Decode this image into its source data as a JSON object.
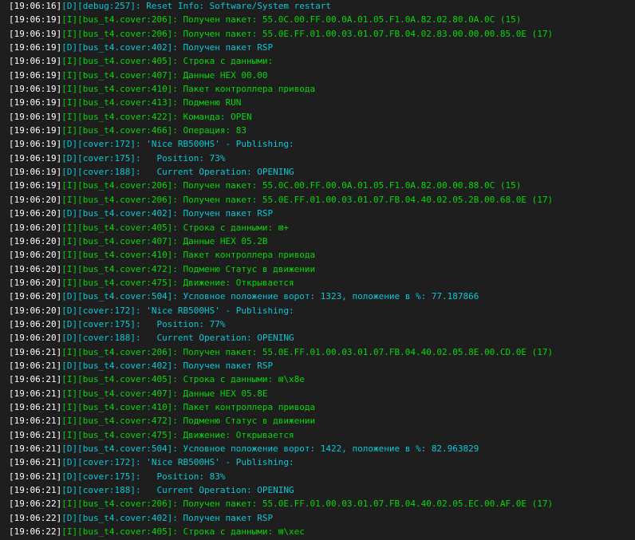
{
  "console": {
    "lines": [
      {
        "timestamp": "[19:06:16]",
        "level": "D",
        "message": "[D][debug:257]: Reset Info: Software/System restart"
      },
      {
        "timestamp": "[19:06:19]",
        "level": "I",
        "message": "[I][bus_t4.cover:206]: Получен пакет: 55.0C.00.FF.00.0A.01.05.F1.0A.82.02.80.0A.0C (15)"
      },
      {
        "timestamp": "[19:06:19]",
        "level": "I",
        "message": "[I][bus_t4.cover:206]: Получен пакет: 55.0E.FF.01.00.03.01.07.FB.04.02.83.00.00.00.85.0E (17)"
      },
      {
        "timestamp": "[19:06:19]",
        "level": "D",
        "message": "[D][bus_t4.cover:402]: Получен пакет RSP"
      },
      {
        "timestamp": "[19:06:19]",
        "level": "I",
        "message": "[I][bus_t4.cover:405]: Строка с данными:"
      },
      {
        "timestamp": "[19:06:19]",
        "level": "I",
        "message": "[I][bus_t4.cover:407]: Данные HEX 00.00"
      },
      {
        "timestamp": "[19:06:19]",
        "level": "I",
        "message": "[I][bus_t4.cover:410]: Пакет контроллера привода"
      },
      {
        "timestamp": "[19:06:19]",
        "level": "I",
        "message": "[I][bus_t4.cover:413]: Подменю RUN"
      },
      {
        "timestamp": "[19:06:19]",
        "level": "I",
        "message": "[I][bus_t4.cover:422]: Команда: OPEN"
      },
      {
        "timestamp": "[19:06:19]",
        "level": "I",
        "message": "[I][bus_t4.cover:466]: Операция: 83"
      },
      {
        "timestamp": "[19:06:19]",
        "level": "D",
        "message": "[D][cover:172]: 'Nice RB500HS' - Publishing:"
      },
      {
        "timestamp": "[19:06:19]",
        "level": "D",
        "message": "[D][cover:175]:   Position: 73%"
      },
      {
        "timestamp": "[19:06:19]",
        "level": "D",
        "message": "[D][cover:188]:   Current Operation: OPENING"
      },
      {
        "timestamp": "[19:06:19]",
        "level": "I",
        "message": "[I][bus_t4.cover:206]: Получен пакет: 55.0C.00.FF.00.0A.01.05.F1.0A.82.00.00.88.0C (15)"
      },
      {
        "timestamp": "[19:06:20]",
        "level": "I",
        "message": "[I][bus_t4.cover:206]: Получен пакет: 55.0E.FF.01.00.03.01.07.FB.04.40.02.05.2B.00.68.0E (17)"
      },
      {
        "timestamp": "[19:06:20]",
        "level": "D",
        "message": "[D][bus_t4.cover:402]: Получен пакет RSP"
      },
      {
        "timestamp": "[19:06:20]",
        "level": "I",
        "message": "[I][bus_t4.cover:405]: Строка с данными: ⊠+"
      },
      {
        "timestamp": "[19:06:20]",
        "level": "I",
        "message": "[I][bus_t4.cover:407]: Данные HEX 05.2B"
      },
      {
        "timestamp": "[19:06:20]",
        "level": "I",
        "message": "[I][bus_t4.cover:410]: Пакет контроллера привода"
      },
      {
        "timestamp": "[19:06:20]",
        "level": "I",
        "message": "[I][bus_t4.cover:472]: Подменю Статус в движении"
      },
      {
        "timestamp": "[19:06:20]",
        "level": "I",
        "message": "[I][bus_t4.cover:475]: Движение: Открывается"
      },
      {
        "timestamp": "[19:06:20]",
        "level": "D",
        "message": "[D][bus_t4.cover:504]: Условное положение ворот: 1323, положение в %: 77.187866"
      },
      {
        "timestamp": "[19:06:20]",
        "level": "D",
        "message": "[D][cover:172]: 'Nice RB500HS' - Publishing:"
      },
      {
        "timestamp": "[19:06:20]",
        "level": "D",
        "message": "[D][cover:175]:   Position: 77%"
      },
      {
        "timestamp": "[19:06:20]",
        "level": "D",
        "message": "[D][cover:188]:   Current Operation: OPENING"
      },
      {
        "timestamp": "[19:06:21]",
        "level": "I",
        "message": "[I][bus_t4.cover:206]: Получен пакет: 55.0E.FF.01.00.03.01.07.FB.04.40.02.05.8E.00.CD.0E (17)"
      },
      {
        "timestamp": "[19:06:21]",
        "level": "D",
        "message": "[D][bus_t4.cover:402]: Получен пакет RSP"
      },
      {
        "timestamp": "[19:06:21]",
        "level": "I",
        "message": "[I][bus_t4.cover:405]: Строка с данными: ⊠\\x8e"
      },
      {
        "timestamp": "[19:06:21]",
        "level": "I",
        "message": "[I][bus_t4.cover:407]: Данные HEX 05.8E"
      },
      {
        "timestamp": "[19:06:21]",
        "level": "I",
        "message": "[I][bus_t4.cover:410]: Пакет контроллера привода"
      },
      {
        "timestamp": "[19:06:21]",
        "level": "I",
        "message": "[I][bus_t4.cover:472]: Подменю Статус в движении"
      },
      {
        "timestamp": "[19:06:21]",
        "level": "I",
        "message": "[I][bus_t4.cover:475]: Движение: Открывается"
      },
      {
        "timestamp": "[19:06:21]",
        "level": "D",
        "message": "[D][bus_t4.cover:504]: Условное положение ворот: 1422, положение в %: 82.963829"
      },
      {
        "timestamp": "[19:06:21]",
        "level": "D",
        "message": "[D][cover:172]: 'Nice RB500HS' - Publishing:"
      },
      {
        "timestamp": "[19:06:21]",
        "level": "D",
        "message": "[D][cover:175]:   Position: 83%"
      },
      {
        "timestamp": "[19:06:21]",
        "level": "D",
        "message": "[D][cover:188]:   Current Operation: OPENING"
      },
      {
        "timestamp": "[19:06:22]",
        "level": "I",
        "message": "[I][bus_t4.cover:206]: Получен пакет: 55.0E.FF.01.00.03.01.07.FB.04.40.02.05.EC.00.AF.0E (17)"
      },
      {
        "timestamp": "[19:06:22]",
        "level": "D",
        "message": "[D][bus_t4.cover:402]: Получен пакет RSP"
      },
      {
        "timestamp": "[19:06:22]",
        "level": "I",
        "message": "[I][bus_t4.cover:405]: Строка с данными: ⊠\\xec"
      }
    ]
  },
  "colors": {
    "background": "#1e1e1e",
    "timestamp": "#ffffff",
    "info": "#00d700",
    "debug": "#00c8d7"
  }
}
